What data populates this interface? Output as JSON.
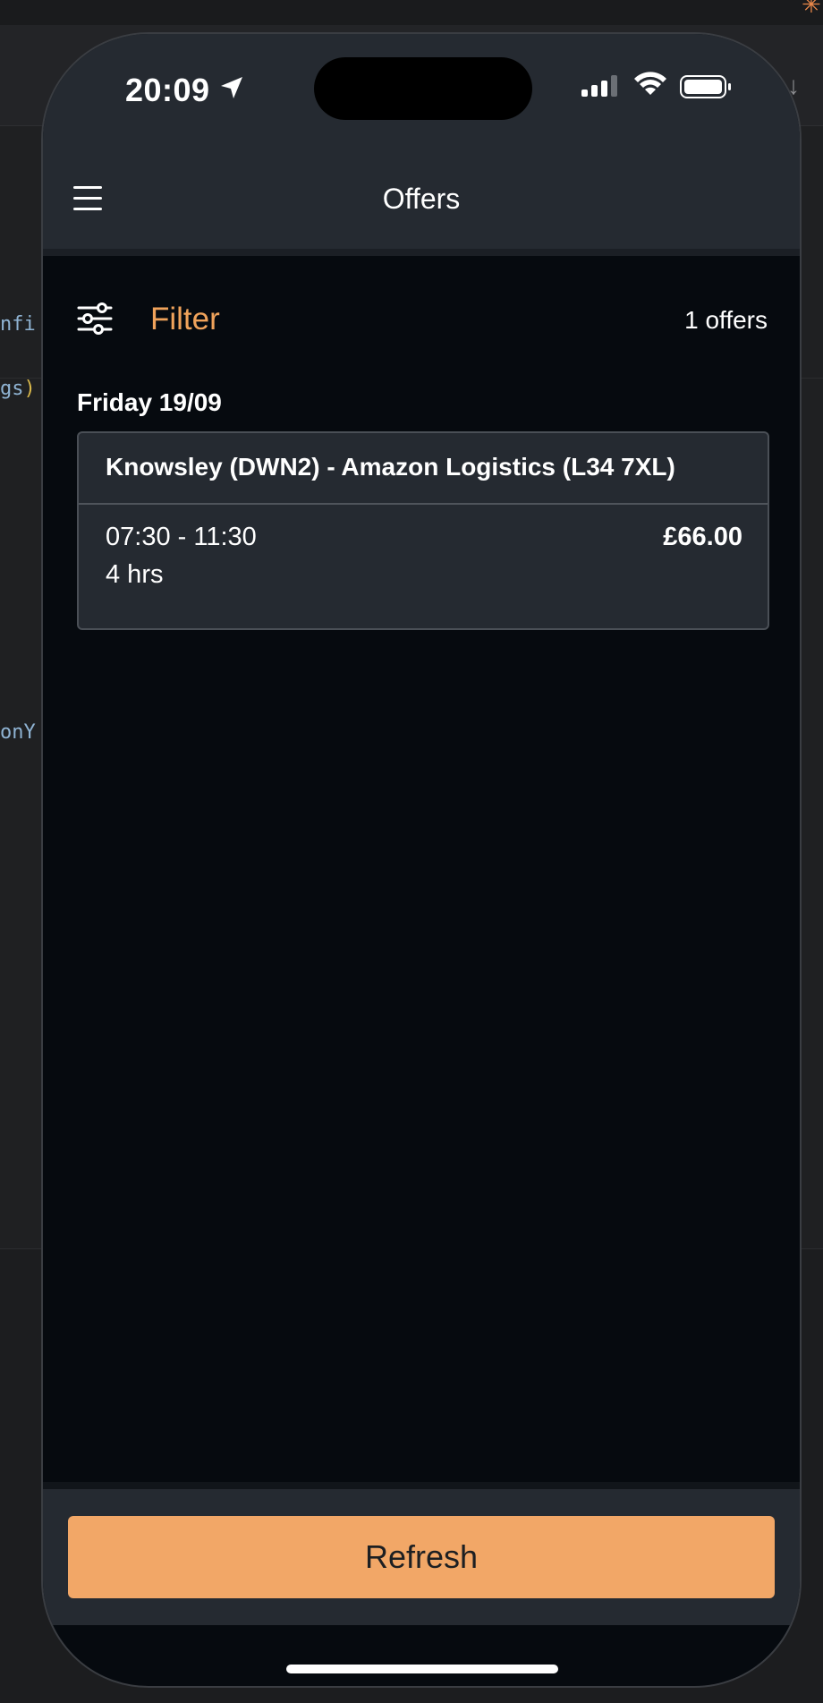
{
  "ide": {
    "code_lines": [
      {
        "text": "nfi",
        "yellow": ""
      },
      {
        "text": "gs",
        "yellow": ")"
      },
      {
        "text": "onY",
        "yellow": ""
      }
    ],
    "arrow": "↓",
    "star": "✳"
  },
  "status_bar": {
    "time": "20:09"
  },
  "nav": {
    "title": "Offers",
    "menu_icon": "hamburger-icon"
  },
  "filter": {
    "label": "Filter",
    "icon": "sliders-icon",
    "count_text": "1 offers"
  },
  "offers": {
    "day": "Friday 19/09",
    "items": [
      {
        "location": "Knowsley (DWN2) - Amazon Logistics (L34 7XL)",
        "time_range": "07:30 - 11:30",
        "duration": "4 hrs",
        "price": "£66.00"
      }
    ]
  },
  "refresh_button": {
    "label": "Refresh"
  },
  "colors": {
    "accent": "#f2a767",
    "filter_text": "#f0a35b",
    "background": "#060a0f",
    "panel": "#252a31"
  }
}
